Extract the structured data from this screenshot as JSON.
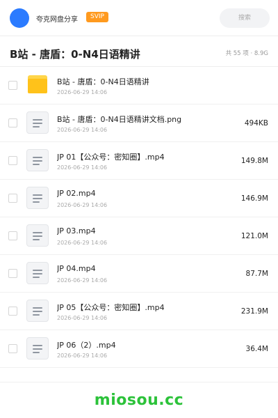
{
  "header": {
    "share_title": "夸克网盘分享",
    "badge": "SVIP",
    "search_placeholder": "搜索"
  },
  "folder": {
    "title": "B站 - 唐盾：0-N4日语精讲",
    "meta": "共 55 项 · 8.9G"
  },
  "files": [
    {
      "name": "B站 - 唐盾：0-N4日语精讲",
      "date": "2026-06-29 14:06",
      "size": "",
      "type": "folder"
    },
    {
      "name": "B站 - 唐盾：0-N4日语精讲文档.png",
      "date": "2026-06-29 14:06",
      "size": "494KB",
      "type": "file"
    },
    {
      "name": "JP 01【公众号：密知圈】.mp4",
      "date": "2026-06-29 14:06",
      "size": "149.8M",
      "type": "file"
    },
    {
      "name": "JP 02.mp4",
      "date": "2026-06-29 14:06",
      "size": "146.9M",
      "type": "file"
    },
    {
      "name": "JP 03.mp4",
      "date": "2026-06-29 14:06",
      "size": "121.0M",
      "type": "file"
    },
    {
      "name": "JP 04.mp4",
      "date": "2026-06-29 14:06",
      "size": "87.7M",
      "type": "file"
    },
    {
      "name": "JP 05【公众号：密知圈】.mp4",
      "date": "2026-06-29 14:06",
      "size": "231.9M",
      "type": "file"
    },
    {
      "name": "JP 06（2）.mp4",
      "date": "2026-06-29 14:06",
      "size": "36.4M",
      "type": "file"
    }
  ],
  "colors": {
    "accent": "#2b7bff",
    "badge": "#ff9a1f",
    "folder": "#ffc21a",
    "watermark": "#2cc23a"
  },
  "watermark": "miosou.cc"
}
